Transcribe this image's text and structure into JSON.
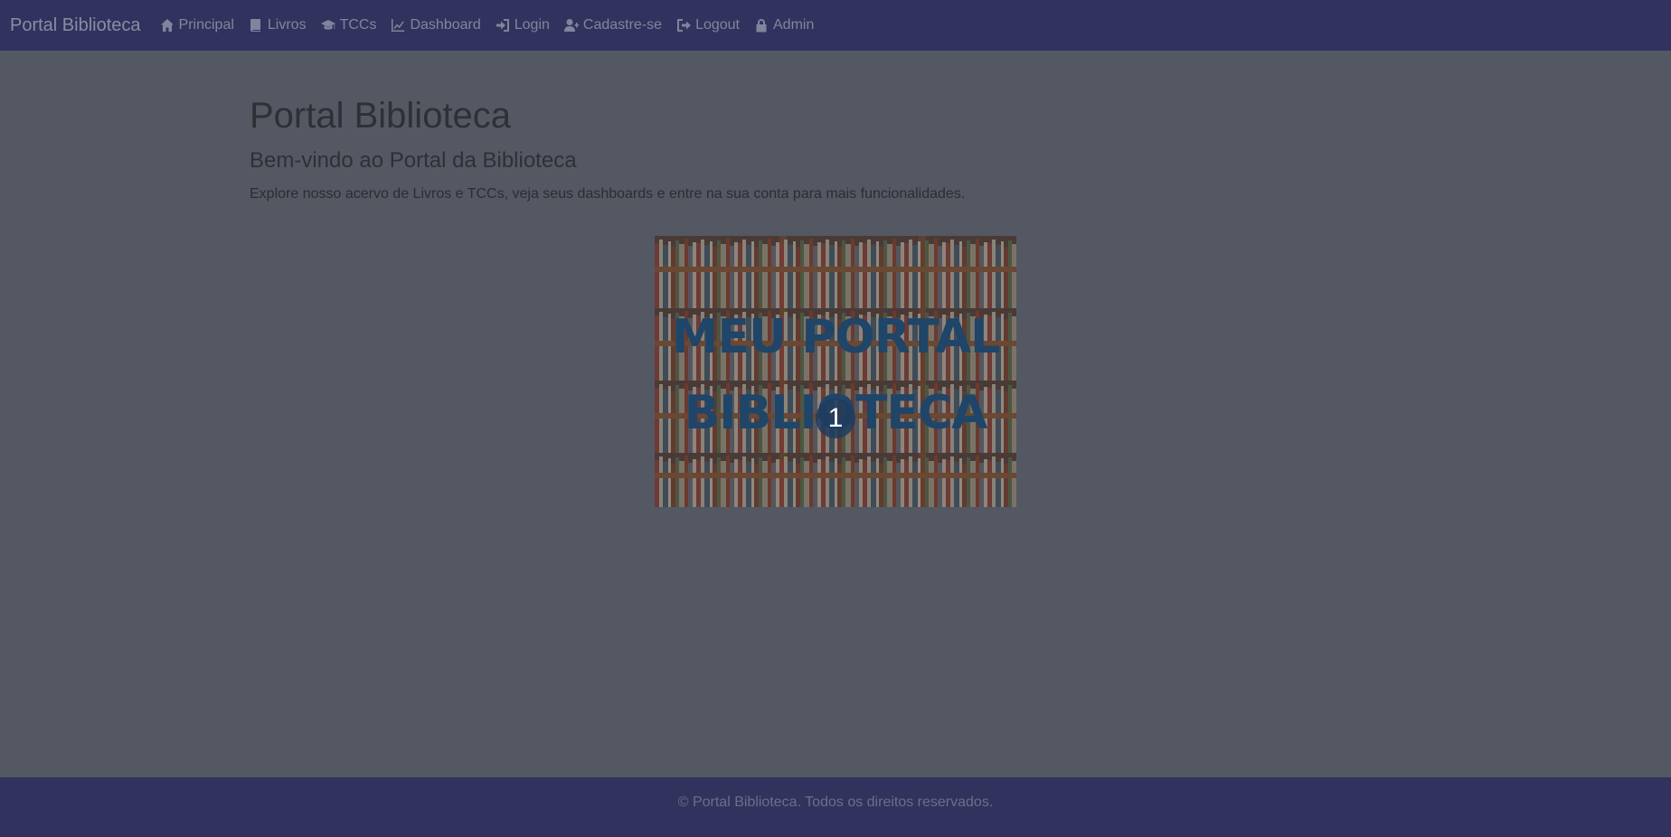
{
  "navbar": {
    "brand": "Portal Biblioteca",
    "items": [
      {
        "label": "Principal",
        "icon": "home-icon"
      },
      {
        "label": "Livros",
        "icon": "book-icon"
      },
      {
        "label": "TCCs",
        "icon": "graduation-cap-icon"
      },
      {
        "label": "Dashboard",
        "icon": "chart-line-icon"
      },
      {
        "label": "Login",
        "icon": "sign-in-icon"
      },
      {
        "label": "Cadastre-se",
        "icon": "user-plus-icon"
      },
      {
        "label": "Logout",
        "icon": "sign-out-icon"
      },
      {
        "label": "Admin",
        "icon": "lock-icon"
      }
    ]
  },
  "main": {
    "title": "Portal Biblioteca",
    "subtitle": "Bem-vindo ao Portal da Biblioteca",
    "lead": "Explore nosso acervo de Livros e TCCs, veja seus dashboards e entre na sua conta para mais funcionalidades."
  },
  "hero": {
    "line1": "MEU PORTAL",
    "line2": "BIBLIOTECA",
    "badge": "1"
  },
  "footer": {
    "text": "© Portal Biblioteca. Todos os direitos reservados."
  },
  "colors": {
    "navbar_bg": "#32325e",
    "page_bg": "#545862",
    "hero_text": "#1f4568"
  }
}
